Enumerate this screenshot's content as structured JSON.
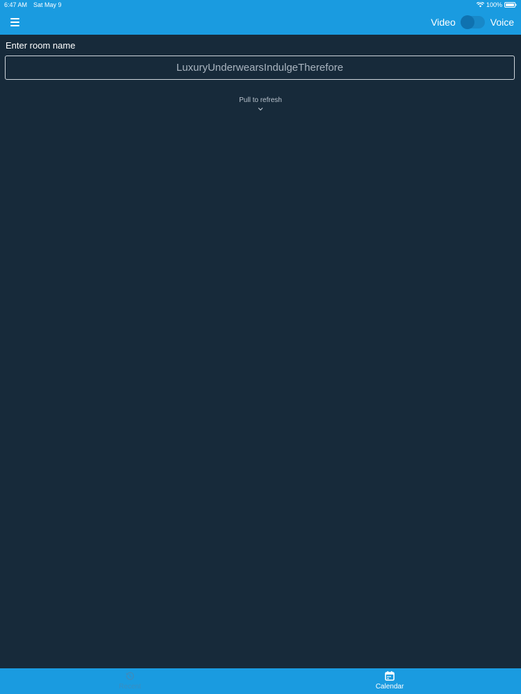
{
  "status_bar": {
    "time": "6:47 AM",
    "date": "Sat May 9",
    "battery": "100%",
    "icons": [
      "wifi-icon",
      "battery-icon"
    ]
  },
  "app_bar": {
    "menu_icon": "hamburger-menu-icon",
    "toggle_left_label": "Video",
    "toggle_right_label": "Voice",
    "toggle_state": "off"
  },
  "form": {
    "room_label": "Enter room name",
    "room_placeholder": "LuxuryUnderwearsIndulgeTherefore",
    "room_value": ""
  },
  "pull_to_refresh": {
    "text": "Pull to refresh",
    "icon": "chevron-down-icon"
  },
  "tab_bar": {
    "tabs": [
      {
        "label": "Recent",
        "icon": "history-icon",
        "active": false
      },
      {
        "label": "Calendar",
        "icon": "calendar-icon",
        "active": true
      }
    ]
  },
  "colors": {
    "accent": "#1a9be0",
    "background": "#172a3a",
    "inactive_tab": "#3a8dc0",
    "text_muted": "#a9b4bf"
  }
}
